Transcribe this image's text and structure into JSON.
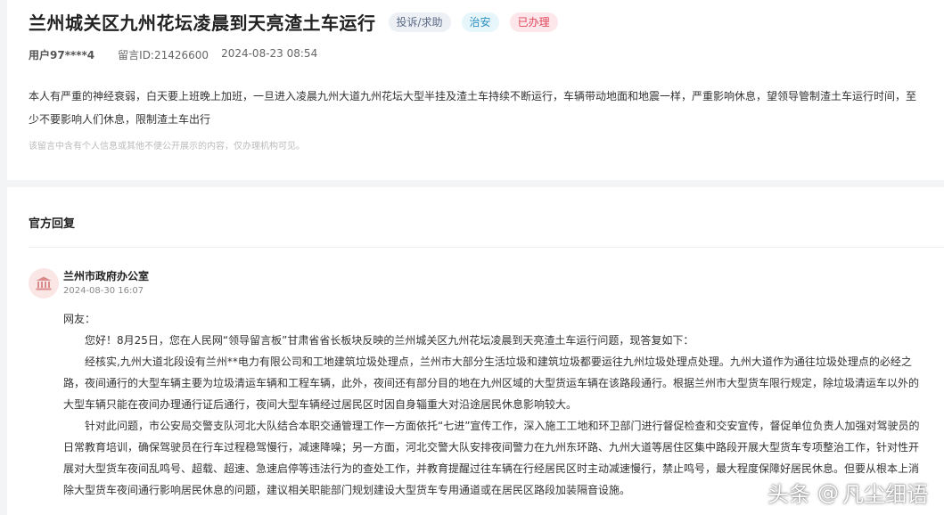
{
  "message": {
    "title": "兰州城关区九州花坛凌晨到天亮渣土车运行",
    "tags": {
      "type": "投诉/求助",
      "category": "治安",
      "status": "已办理"
    },
    "user": "用户97****4",
    "message_id": "留言ID:21426600",
    "datetime": "2024-08-23 08:54",
    "content": "本人有严重的神经衰弱，白天要上班晚上加班，一旦进入凌晨九州大道九州花坛大型半挂及渣土车持续不断运行，车辆带动地面和地震一样，严重影响休息，望领导管制渣土车运行时间，至少不要影响人们休息，限制渣土车出行",
    "privacy_note": "该留言中含有个人信息或其他不便公开展示的内容，仅办理机构可见。"
  },
  "reply": {
    "heading": "官方回复",
    "org_icon": "government-building-icon",
    "org_name": "兰州市政府办公室",
    "datetime": "2024-08-30 16:07",
    "greeting": "网友：",
    "paragraphs": [
      "您好！8月25日，您在人民网“领导留言板”甘肃省省长板块反映的兰州城关区九州花坛凌晨到天亮渣土车运行问题，现答复如下：",
      "经核实,九州大道北段设有兰州**电力有限公司和工地建筑垃圾处理点，兰州市大部分生活垃圾和建筑垃圾都要运往九州垃圾处理点处理。九州大道作为通往垃圾处理点的必经之路，夜间通行的大型车辆主要为垃圾清运车辆和工程车辆，此外，夜间还有部分目的地在九州区域的大型货运车辆在该路段通行。根据兰州市大型货车限行规定，除垃圾清运车以外的大型车辆只能在夜间办理通行证后通行，夜间大型车辆经过居民区时因自身辎重大对沿途居民休息影响较大。",
      "针对此问题，市公安局交警支队河北大队结合本职交通管理工作一方面依托“七进”宣传工作，深入施工工地和环卫部门进行督促检查和交安宣传，督促单位负责人加强对驾驶员的日常教育培训，确保驾驶员在行车过程稳驾慢行，减速降噪；另一方面，河北交警大队安排夜间警力在九州东环路、九州大道等居住区集中路段开展大型货车专项整治工作，针对性开展对大型货车夜间乱鸣号、超载、超速、急速启停等违法行为的查处工作，并教育提醒过往车辆在行经居民区时主动减速慢行，禁止鸣号，最大程度保障好居民休息。但要从根本上消除大型货车夜间通行影响居民休息的问题，建议相关职能部门规划建设大型货车专用通道或在居民区路段加装隔音设施。"
    ]
  },
  "watermark": {
    "brand": "头条",
    "at": "@",
    "author": "凡尘细语"
  }
}
